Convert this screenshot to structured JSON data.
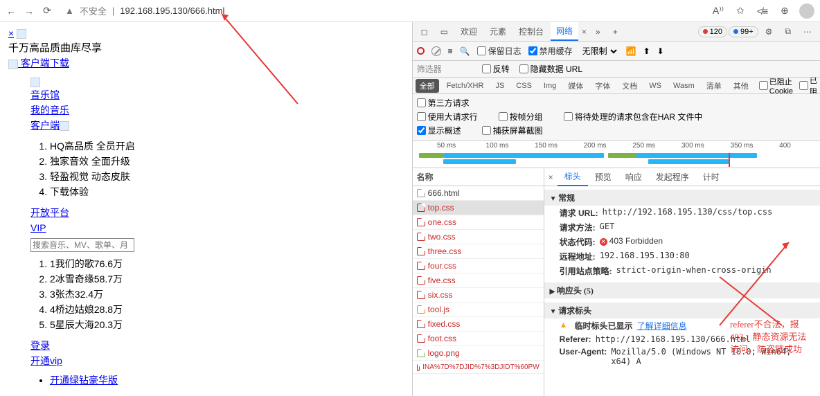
{
  "chrome": {
    "insecure": "不安全",
    "url": "192.168.195.130/666.html"
  },
  "page": {
    "close": "×",
    "headline": "千万高品质曲库尽享",
    "download": " 客户端下载",
    "nav": [
      "音乐馆",
      "我的音乐",
      "客户端"
    ],
    "features": [
      "HQ高品质 全员开启",
      "独家音效 全面升级",
      "轻盈视觉 动态皮肤",
      "下载体验"
    ],
    "links2": [
      "开放平台",
      "VIP"
    ],
    "search_ph": "搜索音乐、MV、歌单、月",
    "hot": [
      "1我们的歌76.6万",
      "2冰雪奇缘58.7万",
      "3张杰32.4万",
      "4桥边姑娘28.8万",
      "5星辰大海20.3万"
    ],
    "login": "登录",
    "openvip": "开通vip",
    "green": "开通绿钻豪华版"
  },
  "dev": {
    "tabs": [
      "欢迎",
      "元素",
      "控制台",
      "网络"
    ],
    "badge_red": "120",
    "badge_blue": "99+",
    "keep_log": "保留日志",
    "disable_cache": "禁用缓存",
    "throttle": "无限制",
    "filter_ph": "筛选器",
    "invert": "反转",
    "hide_data": "隐藏数据 URL",
    "types": [
      "全部",
      "Fetch/XHR",
      "JS",
      "CSS",
      "Img",
      "媒体",
      "字体",
      "文档",
      "WS",
      "Wasm",
      "清单",
      "其他"
    ],
    "blocked_cookie": "已阻止 Cookie",
    "blocked_req": "已阻",
    "third_party": "第三方请求",
    "large_rows": "使用大请求行",
    "group_frame": "按帧分组",
    "har_pending": "将待处理的请求包含在HAR 文件中",
    "show_overview": "显示概述",
    "capture_ss": "捕获屏幕截图",
    "ticks": [
      "50 ms",
      "100 ms",
      "150 ms",
      "200 ms",
      "250 ms",
      "300 ms",
      "350 ms",
      "400"
    ],
    "name_hdr": "名称",
    "reqs": [
      "666.html",
      "top.css",
      "one.css",
      "two.css",
      "three.css",
      "four.css",
      "five.css",
      "six.css",
      "tool.js",
      "fixed.css",
      "foot.css",
      "logo.png",
      "INA%7D%7DJID%7%3DJIDT%60PW"
    ],
    "detail_tabs": [
      "标头",
      "预览",
      "响应",
      "发起程序",
      "计时"
    ],
    "general": "常规",
    "req_url_k": "请求 URL:",
    "req_url_v": "http://192.168.195.130/css/top.css",
    "method_k": "请求方法:",
    "method_v": "GET",
    "status_k": "状态代码:",
    "status_v": "403 Forbidden",
    "remote_k": "远程地址:",
    "remote_v": "192.168.195.130:80",
    "refpol_k": "引用站点策略:",
    "refpol_v": "strict-origin-when-cross-origin",
    "resp_hdr": "响应头 (5)",
    "req_hdr": "请求标头",
    "prov_hdr": "临时标头已显示",
    "prov_link": "了解详细信息",
    "referer_k": "Referer:",
    "referer_v": "http://192.168.195.130/666.html",
    "ua_k": "User-Agent:",
    "ua_v": "Mozilla/5.0 (Windows NT 10.0; Win64; x64) A"
  },
  "annot": "referer不合法，报403，静态资源无法访问，防盗链成功"
}
